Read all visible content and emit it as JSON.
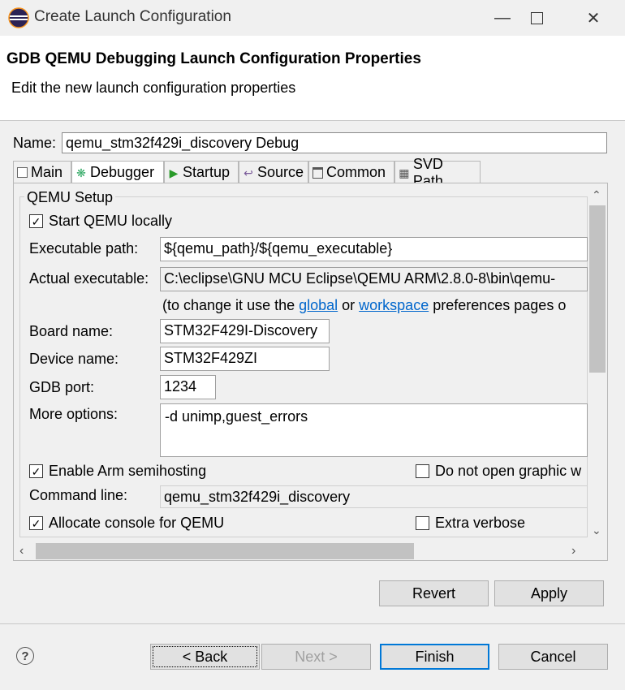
{
  "window": {
    "title": "Create Launch Configuration",
    "icon": "eclipse-icon",
    "controls": [
      "minimize",
      "maximize",
      "close"
    ]
  },
  "header": {
    "title": "GDB QEMU Debugging Launch Configuration Properties",
    "description": "Edit the new launch configuration properties"
  },
  "name": {
    "label": "Name:",
    "value": "qemu_stm32f429i_discovery Debug"
  },
  "tabs": [
    {
      "label": "Main",
      "icon": "main-tab-icon"
    },
    {
      "label": "Debugger",
      "icon": "debugger-tab-icon",
      "active": true
    },
    {
      "label": "Startup",
      "icon": "startup-tab-icon"
    },
    {
      "label": "Source",
      "icon": "source-tab-icon"
    },
    {
      "label": "Common",
      "icon": "common-tab-icon"
    },
    {
      "label": "SVD Path",
      "icon": "svd-tab-icon"
    }
  ],
  "qemu": {
    "group_title": "QEMU Setup",
    "start_locally": {
      "label": "Start QEMU locally",
      "checked": true
    },
    "executable_path": {
      "label": "Executable path:",
      "value": "${qemu_path}/${qemu_executable}"
    },
    "actual_executable": {
      "label": "Actual executable:",
      "value": "C:\\eclipse\\GNU MCU Eclipse\\QEMU ARM\\2.8.0-8\\bin\\qemu-"
    },
    "hint": {
      "prefix": "(to change it use the ",
      "link1": "global",
      "middle": " or ",
      "link2": "workspace",
      "suffix": " preferences pages o"
    },
    "board_name": {
      "label": "Board name:",
      "value": "STM32F429I-Discovery"
    },
    "device_name": {
      "label": "Device name:",
      "value": "STM32F429ZI"
    },
    "gdb_port": {
      "label": "GDB port:",
      "value": "1234"
    },
    "more_options": {
      "label": "More options:",
      "value": "-d unimp,guest_errors"
    },
    "semihosting": {
      "label": "Enable Arm semihosting",
      "checked": true
    },
    "no_graphic": {
      "label": "Do not open graphic w",
      "checked": false
    },
    "command_line": {
      "label": "Command line:",
      "value": "qemu_stm32f429i_discovery"
    },
    "allocate_console": {
      "label": "Allocate console for QEMU",
      "checked": true
    },
    "extra_verbose": {
      "label": "Extra verbose",
      "checked": false
    }
  },
  "buttons": {
    "revert": "Revert",
    "apply": "Apply",
    "back": "< Back",
    "next": "Next >",
    "finish": "Finish",
    "cancel": "Cancel"
  },
  "help": "?"
}
